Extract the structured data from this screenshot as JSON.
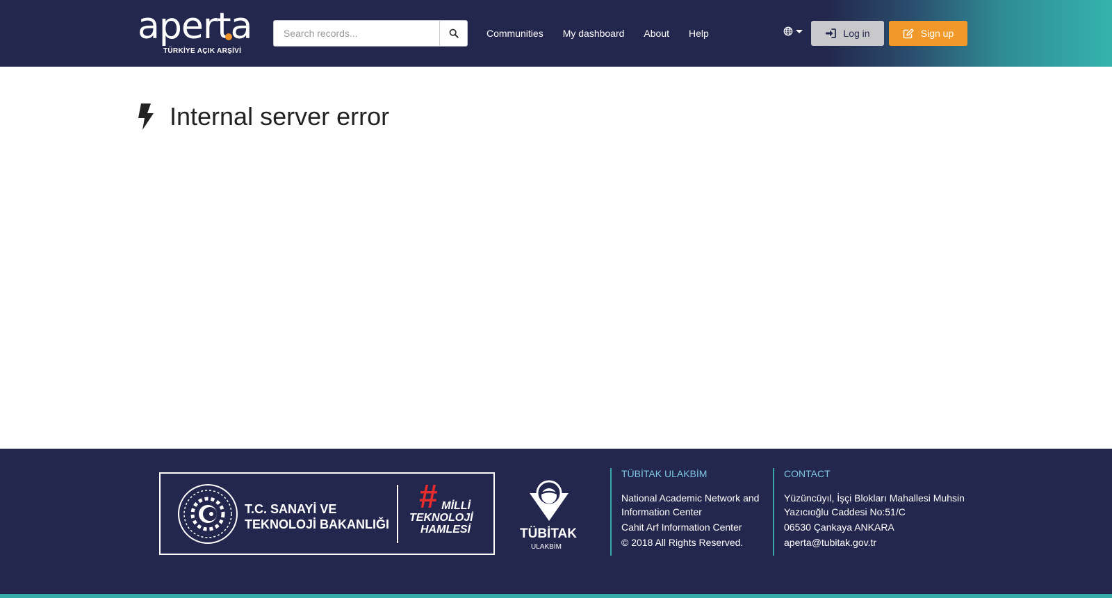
{
  "header": {
    "logo_word": "aperta",
    "logo_subtitle": "TÜRKİYE AÇIK ARŞİVİ",
    "search_placeholder": "Search records...",
    "nav": [
      "Communities",
      "My dashboard",
      "About",
      "Help"
    ],
    "login_label": "Log in",
    "signup_label": "Sign up"
  },
  "main": {
    "error_title": "Internal server error"
  },
  "footer": {
    "ministry_line1": "T.C. SANAYİ VE",
    "ministry_line2": "TEKNOLOJİ BAKANLIĞI",
    "milli_line1": "MİLLİ",
    "milli_line2": "TEKNOLOJİ",
    "milli_line3": "HAMLESİ",
    "tubitak_name": "TÜBİTAK",
    "tubitak_sub": "ULAKBİM",
    "col1_title": "TÜBİTAK ULAKBİM",
    "col1_lines": [
      "National Academic Network and Information Center",
      "Cahit Arf Information Center",
      "© 2018 All Rights Reserved."
    ],
    "col2_title": "CONTACT",
    "col2_lines": [
      "Yüzüncüyıl, İşçi Blokları Mahallesi Muhsin Yazıcıoğlu Caddesi No:51/C",
      "06530 Çankaya ANKARA",
      "aperta@tubitak.gov.tr"
    ]
  },
  "colors": {
    "header_bg": "#23264d",
    "accent_teal": "#35aaa6",
    "accent_orange": "#f0992a",
    "login_bg": "#c9c9cb"
  },
  "icons": [
    "search-icon",
    "globe-icon",
    "sign-in-icon",
    "edit-icon",
    "bolt-icon"
  ]
}
